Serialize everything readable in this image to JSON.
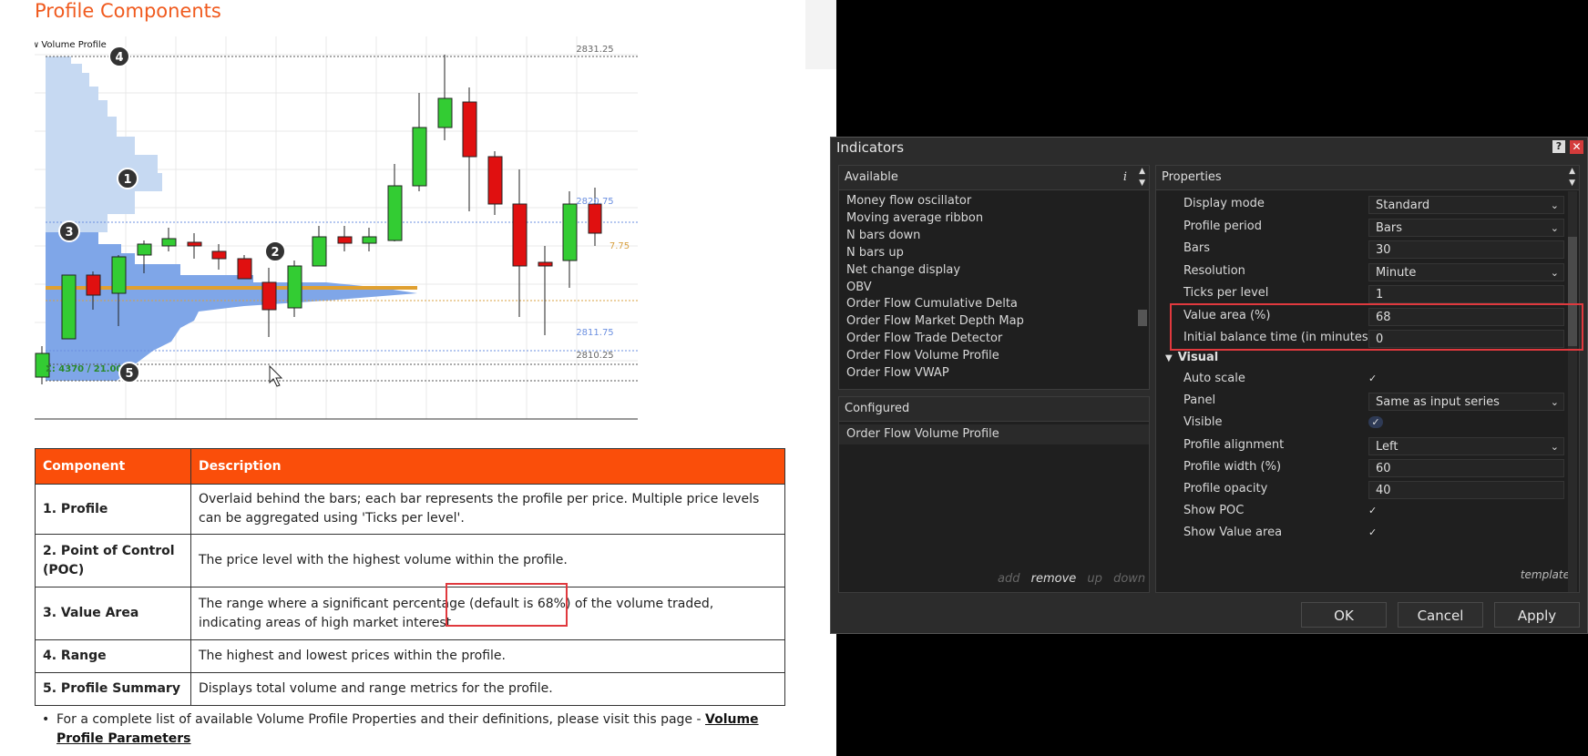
{
  "doc": {
    "title": "Profile Components",
    "chart": {
      "header": "w Volume Profile",
      "price_top": "2831.25",
      "price_vah": "2820.75",
      "price_poc": "7.75",
      "price_val": "2811.75",
      "price_low": "2810.25",
      "summary": "Σ: 4370 / 21.00",
      "callouts": [
        "1",
        "2",
        "3",
        "4",
        "5"
      ]
    },
    "table": {
      "headers": [
        "Component",
        "Description"
      ],
      "rows": [
        {
          "component": "1. Profile",
          "description": "Overlaid behind the bars; each bar represents the profile per price. Multiple price levels can be aggregated using 'Ticks per level'."
        },
        {
          "component": "2. Point of Control (POC)",
          "description": "The price level with the highest volume within the profile."
        },
        {
          "component": "3. Value Area",
          "description": "The range where a significant percentage (default is 68%) of the volume traded, indicating areas of high market interest."
        },
        {
          "component": "4. Range",
          "description": "The highest and lowest prices within the profile."
        },
        {
          "component": "5. Profile Summary",
          "description": "Displays total volume and range metrics for the profile."
        }
      ]
    },
    "note": {
      "text": "For a complete list of available Volume Profile Properties and their definitions, please visit this page - ",
      "link": "Volume Profile Parameters"
    }
  },
  "dialog": {
    "title": "Indicators",
    "help": "?",
    "close": "✕",
    "available": {
      "header": "Available",
      "info": "i",
      "items": [
        "Money flow oscillator",
        "Moving average ribbon",
        "N bars down",
        "N bars up",
        "Net change display",
        "OBV",
        "Order Flow Cumulative Delta",
        "Order Flow Market Depth Map",
        "Order Flow Trade Detector",
        "Order Flow Volume Profile",
        "Order Flow VWAP"
      ]
    },
    "configured": {
      "header": "Configured",
      "items": [
        "Order Flow Volume Profile"
      ],
      "actions": {
        "add": "add",
        "remove": "remove",
        "up": "up",
        "down": "down"
      }
    },
    "properties": {
      "header": "Properties",
      "rows": [
        {
          "label": "Display mode",
          "value": "Standard",
          "type": "select"
        },
        {
          "label": "Profile period",
          "value": "Bars",
          "type": "select"
        },
        {
          "label": "Bars",
          "value": "30",
          "type": "text"
        },
        {
          "label": "Resolution",
          "value": "Minute",
          "type": "select"
        },
        {
          "label": "Ticks per level",
          "value": "1",
          "type": "text"
        },
        {
          "label": "Value area (%)",
          "value": "68",
          "type": "text"
        },
        {
          "label": "Initial balance time (in minutes)",
          "value": "0",
          "type": "text"
        }
      ],
      "visual_header": "Visual",
      "visual_rows": [
        {
          "label": "Auto scale",
          "value": "✓",
          "type": "check"
        },
        {
          "label": "Panel",
          "value": "Same as input series",
          "type": "select"
        },
        {
          "label": "Visible",
          "value": "✓",
          "type": "check"
        },
        {
          "label": "Profile alignment",
          "value": "Left",
          "type": "select"
        },
        {
          "label": "Profile width (%)",
          "value": "60",
          "type": "text"
        },
        {
          "label": "Profile opacity",
          "value": "40",
          "type": "text"
        },
        {
          "label": "Show POC",
          "value": "✓",
          "type": "check"
        },
        {
          "label": "Show Value area",
          "value": "✓",
          "type": "check"
        }
      ],
      "template": "template"
    },
    "buttons": {
      "ok": "OK",
      "cancel": "Cancel",
      "apply": "Apply"
    }
  }
}
